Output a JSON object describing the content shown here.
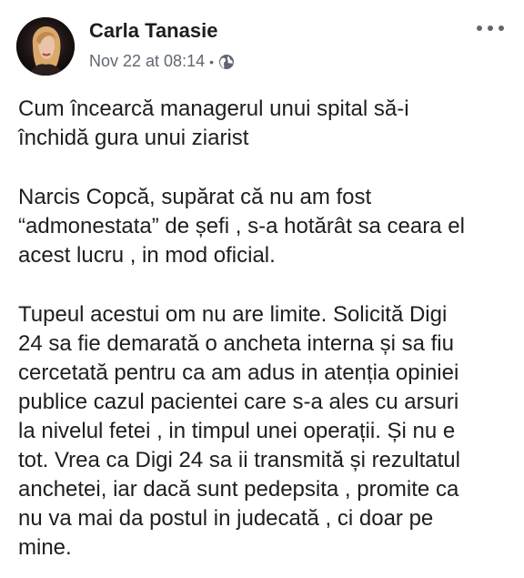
{
  "author": {
    "name": "Carla Tanasie",
    "avatar_icon": "profile-photo"
  },
  "meta": {
    "timestamp": "Nov 22 at 08:14",
    "separator": "•",
    "audience_icon": "globe-icon"
  },
  "menu": {
    "more_icon": "more-horizontal-icon"
  },
  "paragraphs": [
    {
      "lines": [
        "Cum încearcă managerul unui spital să-i",
        "închidă gura unui ziarist"
      ]
    },
    {
      "lines": [
        "Narcis Copcă, supărat că nu am fost",
        "“admonestata” de șefi , s-a hotărât sa ceara el",
        "acest lucru , in mod oficial."
      ]
    },
    {
      "lines": [
        "Tupeul acestui om nu are limite. Solicită Digi",
        "24 sa fie demarată o ancheta interna și sa fiu",
        "cercetată pentru ca am adus in atenția opiniei",
        "publice cazul pacientei care s-a ales cu arsuri",
        "la nivelul fetei , in timpul unei operații. Și nu e",
        "tot. Vrea ca Digi 24 sa ii transmită și rezultatul",
        "anchetei, iar dacă sunt pedepsita , promite ca",
        "nu va mai da postul in judecată , ci doar pe",
        "mine."
      ]
    }
  ],
  "colors": {
    "text": "#1c1e21",
    "secondary": "#606770",
    "background": "#ffffff"
  }
}
